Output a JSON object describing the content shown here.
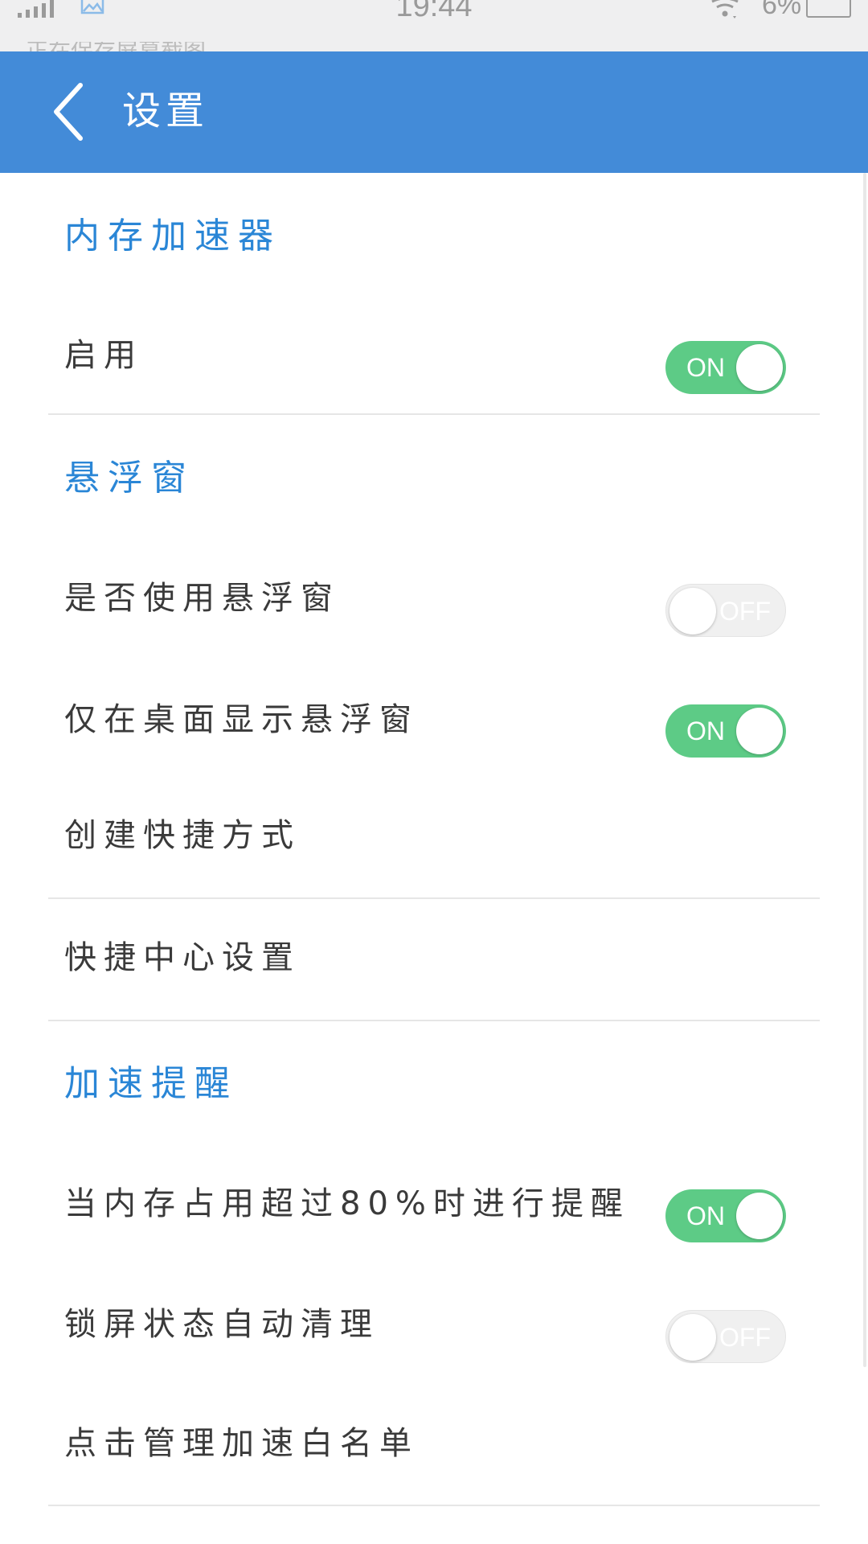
{
  "status_bar": {
    "time": "19:44",
    "battery_text": "6%",
    "notification_text": "正在保存屏幕截图..."
  },
  "header": {
    "title": "设置",
    "back_icon": "chevron-left-icon",
    "color": "#438bd8"
  },
  "sections": [
    {
      "title": "内存加速器",
      "rows": [
        {
          "label": "启用",
          "toggle": "ON"
        }
      ]
    },
    {
      "title": "悬浮窗",
      "rows": [
        {
          "label": "是否使用悬浮窗",
          "toggle": "OFF"
        },
        {
          "label": "仅在桌面显示悬浮窗",
          "toggle": "ON"
        },
        {
          "label": "创建快捷方式"
        },
        {
          "label": "快捷中心设置"
        }
      ]
    },
    {
      "title": "加速提醒",
      "rows": [
        {
          "label": "当内存占用超过80%时进行提醒",
          "toggle": "ON"
        },
        {
          "label": "锁屏状态自动清理",
          "toggle": "OFF"
        },
        {
          "label": "点击管理加速白名单"
        }
      ]
    }
  ],
  "colors": {
    "section_title": "#2a86d6",
    "toggle_on": "#5dcb86",
    "toggle_off": "#f0f0f0"
  }
}
